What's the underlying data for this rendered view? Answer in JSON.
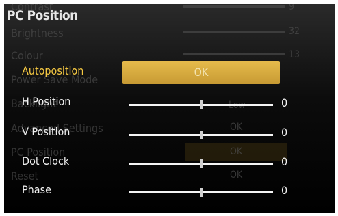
{
  "title": "PC Position",
  "ghost_menu": {
    "items": [
      "Contrast",
      "Brightness",
      "Colour",
      "Power Save Mode",
      "Backlight",
      "Advanced Settings",
      "PC Position",
      "Reset"
    ],
    "values": [
      "9",
      "32",
      "13",
      "Low",
      "OK",
      "OK",
      "OK"
    ]
  },
  "rows": [
    {
      "label": "Autoposition",
      "button": "OK"
    },
    {
      "label": "H Position",
      "value": "0",
      "level": 0.5
    },
    {
      "label": "V Position",
      "value": "0",
      "level": 0.5
    },
    {
      "label": "Dot Clock",
      "value": "0",
      "level": 0.5
    },
    {
      "label": "Phase",
      "value": "0",
      "level": 0.5
    }
  ]
}
